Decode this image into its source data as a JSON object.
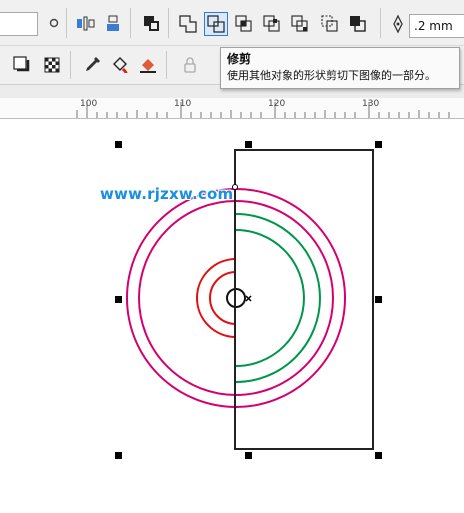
{
  "toolbar": {
    "outline_width": ".2 mm"
  },
  "tooltip": {
    "title": "修剪",
    "description": "使用其他对象的形状剪切下图像的一部分。"
  },
  "ruler": {
    "labels": [
      "100",
      "110",
      "120",
      "130"
    ]
  },
  "canvas": {
    "watermark": "www.rjzxw.com",
    "colors": {
      "magenta": "#d4006e",
      "red": "#e01010",
      "green": "#00964a",
      "black": "#222222"
    }
  }
}
